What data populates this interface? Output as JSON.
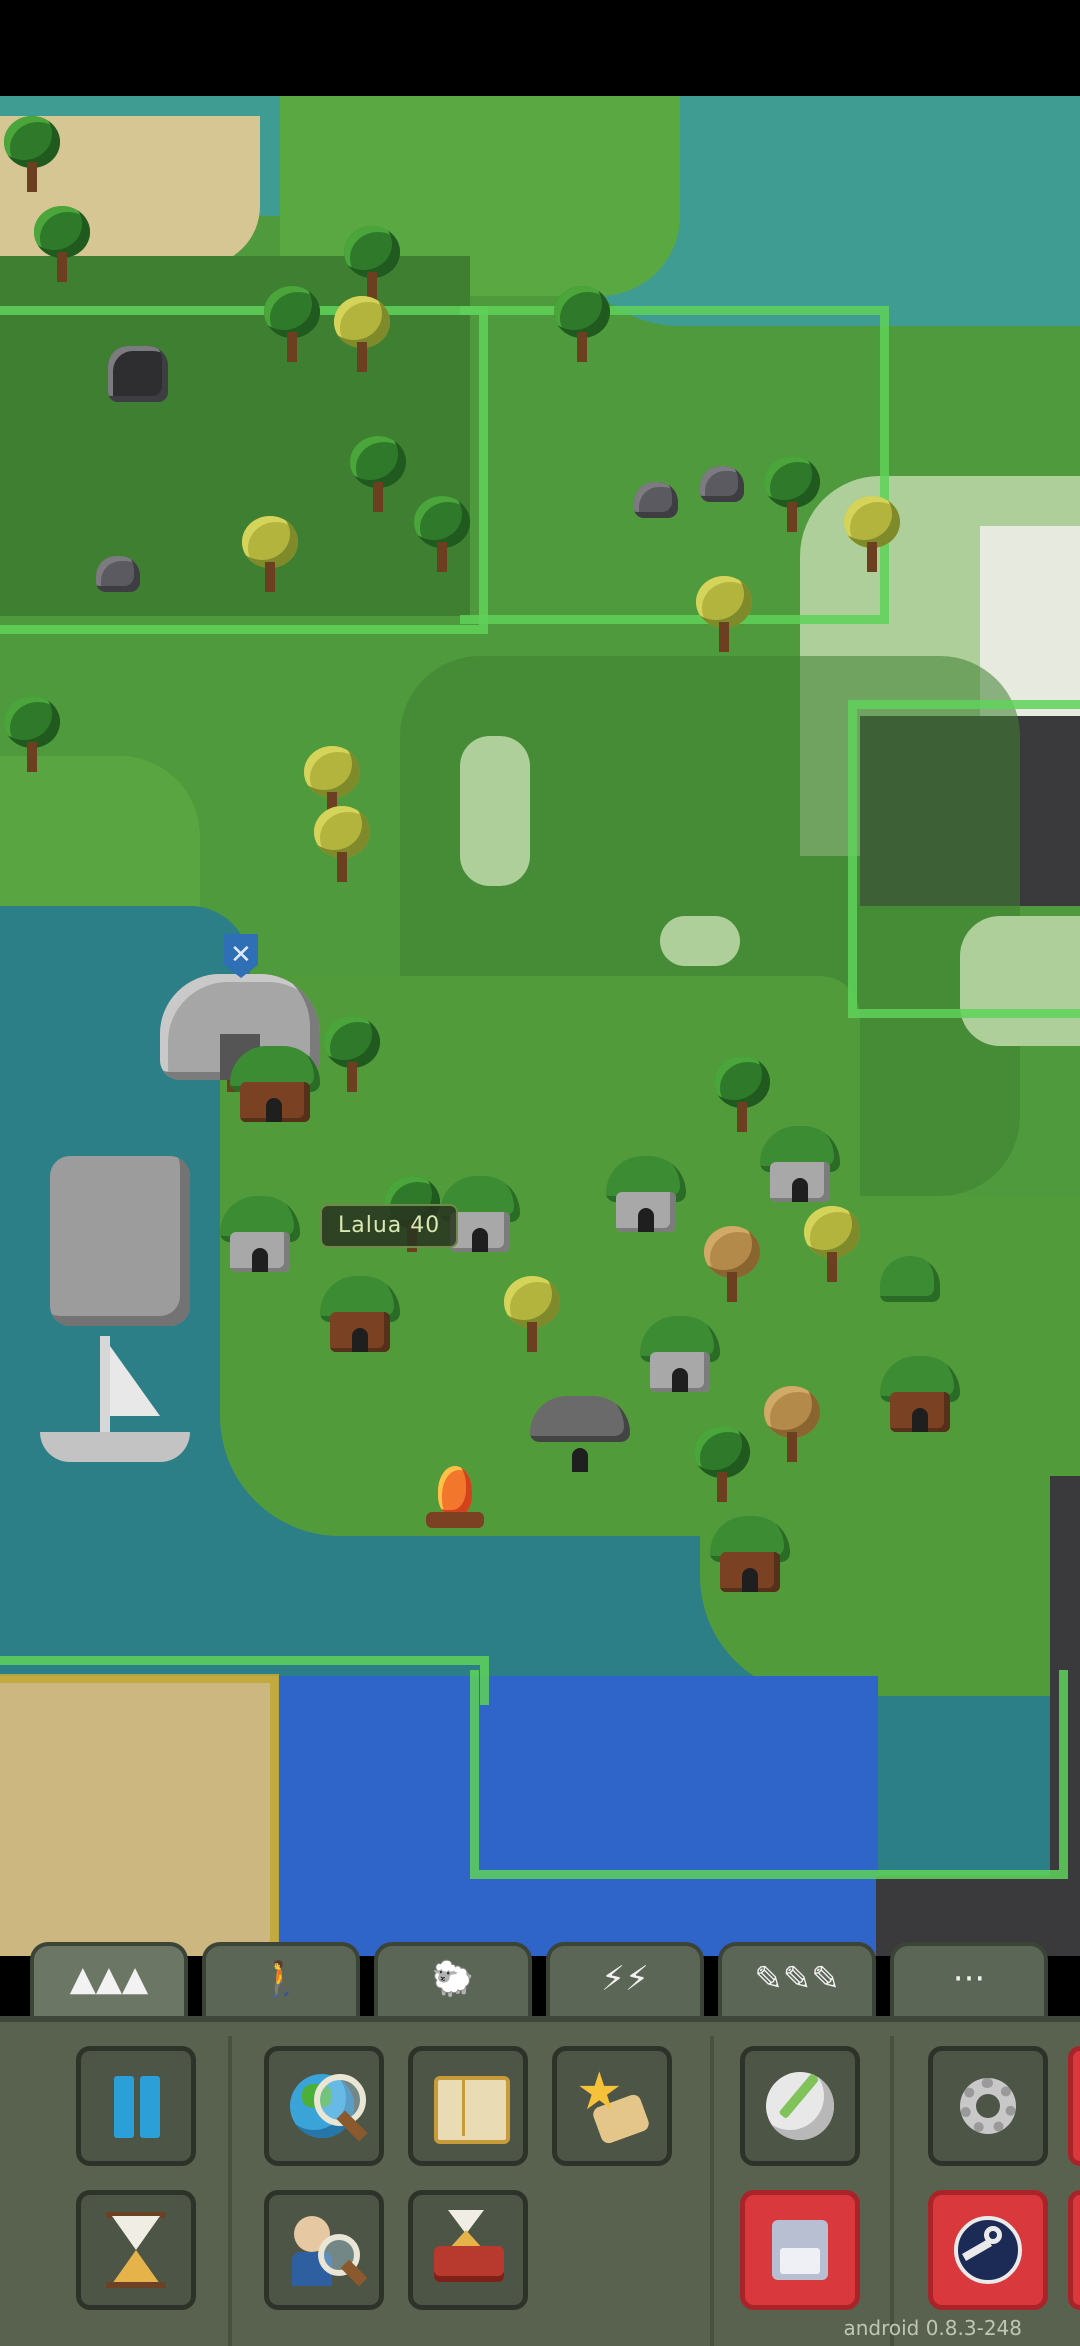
{
  "map": {
    "village_label": "Lalua  40"
  },
  "tabs": [
    {
      "icon": "mountains-icon",
      "glyph": "▲▲▲"
    },
    {
      "icon": "person-icon",
      "glyph": "🚶"
    },
    {
      "icon": "sheep-icon",
      "glyph": "🐑"
    },
    {
      "icon": "lightning-icon",
      "glyph": "⚡⚡"
    },
    {
      "icon": "pencils-icon",
      "glyph": "✎✎✎"
    },
    {
      "icon": "more-icon",
      "glyph": "···"
    }
  ],
  "toolbar": {
    "buttons": [
      {
        "name": "pause-button",
        "icon": "pause-icon"
      },
      {
        "name": "world-info-button",
        "icon": "globe-magnifier-icon"
      },
      {
        "name": "world-laws-button",
        "icon": "open-book-icon"
      },
      {
        "name": "achievements-button",
        "icon": "star-scroll-icon"
      },
      {
        "name": "map-editor-button",
        "icon": "pencil-ball-icon"
      },
      {
        "name": "settings-button",
        "icon": "gear-icon"
      },
      {
        "name": "world-speed-button",
        "icon": "hourglass-icon"
      },
      {
        "name": "inspect-unit-button",
        "icon": "person-magnifier-icon"
      },
      {
        "name": "history-button",
        "icon": "hourglass-book-icon"
      },
      {
        "name": "save-button",
        "icon": "floppy-disk-icon"
      },
      {
        "name": "steam-button",
        "icon": "steam-icon"
      }
    ],
    "colors": {
      "panel": "#59624f",
      "button": "#4c5546",
      "red_button": "#d9383d",
      "pause": "#2b9fd8"
    }
  },
  "footer": {
    "version": "android 0.8.3-248"
  }
}
